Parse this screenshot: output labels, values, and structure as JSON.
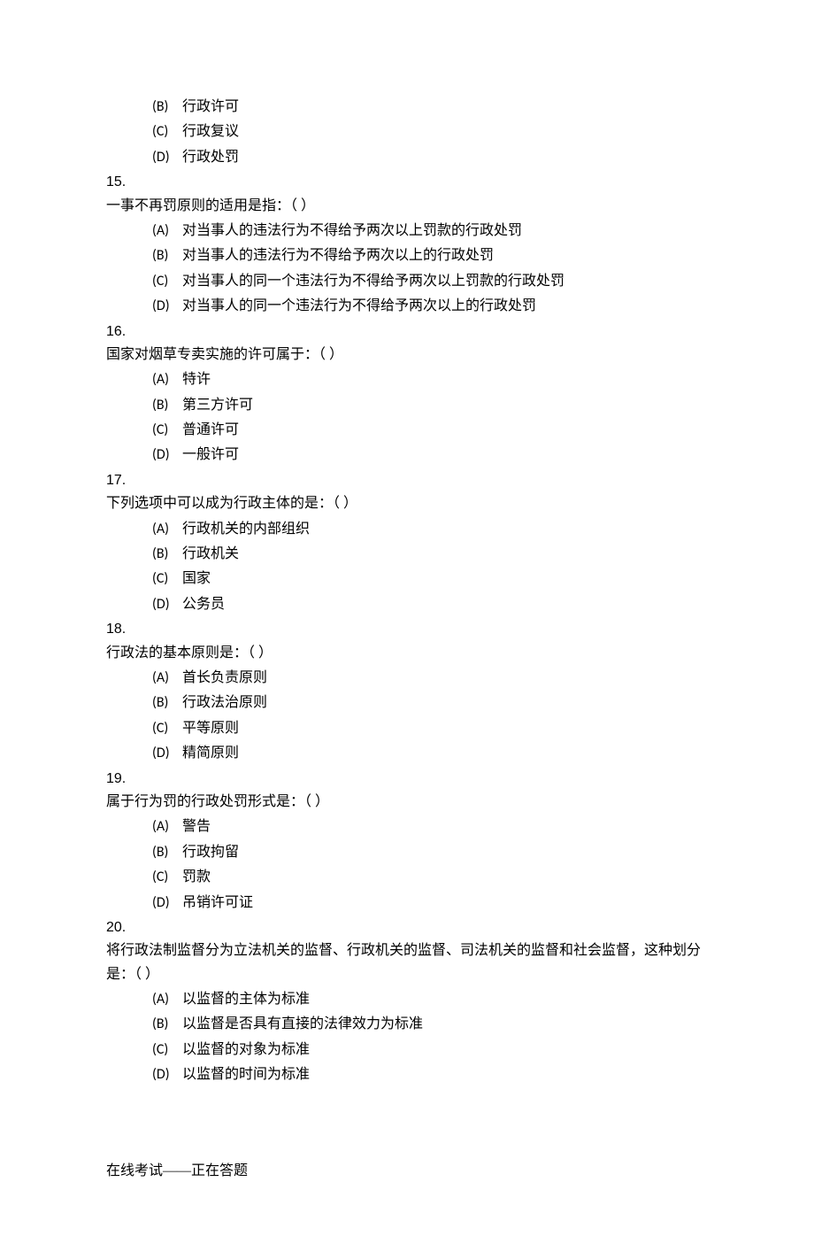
{
  "q14": {
    "opts": {
      "B": "行政许可",
      "C": "行政复议",
      "D": "行政处罚"
    }
  },
  "q15": {
    "num": "15.",
    "stem": "一事不再罚原则的适用是指：（   ）",
    "opts": {
      "A": "对当事人的违法行为不得给予两次以上罚款的行政处罚",
      "B": "对当事人的违法行为不得给予两次以上的行政处罚",
      "C": "对当事人的同一个违法行为不得给予两次以上罚款的行政处罚",
      "D": "对当事人的同一个违法行为不得给予两次以上的行政处罚"
    }
  },
  "q16": {
    "num": "16.",
    "stem": "国家对烟草专卖实施的许可属于：（   ）",
    "opts": {
      "A": "特许",
      "B": "第三方许可",
      "C": "普通许可",
      "D": "一般许可"
    }
  },
  "q17": {
    "num": "17.",
    "stem": "下列选项中可以成为行政主体的是：（   ）",
    "opts": {
      "A": "行政机关的内部组织",
      "B": "行政机关",
      "C": "国家",
      "D": "公务员"
    }
  },
  "q18": {
    "num": "18.",
    "stem": "行政法的基本原则是：（   ）",
    "opts": {
      "A": "首长负责原则",
      "B": "行政法治原则",
      "C": "平等原则",
      "D": "精简原则"
    }
  },
  "q19": {
    "num": "19.",
    "stem": "属于行为罚的行政处罚形式是：（   ）",
    "opts": {
      "A": "警告",
      "B": "行政拘留",
      "C": "罚款",
      "D": "吊销许可证"
    }
  },
  "q20": {
    "num": "20.",
    "stem": "将行政法制监督分为立法机关的监督、行政机关的监督、司法机关的监督和社会监督，这种划分是：（   ）",
    "opts": {
      "A": "以监督的主体为标准",
      "B": "以监督是否具有直接的法律效力为标准",
      "C": "以监督的对象为标准",
      "D": "以监督的时间为标准"
    }
  },
  "labels": {
    "A": "(A)",
    "B": "(B)",
    "C": "(C)",
    "D": "(D)"
  },
  "footer": "在线考试——正在答题"
}
